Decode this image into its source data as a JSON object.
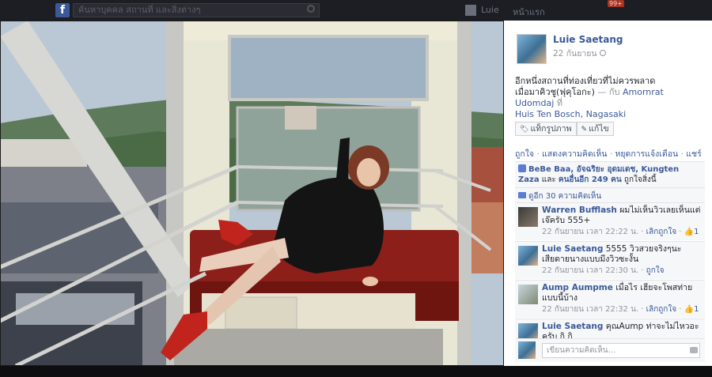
{
  "topbar": {
    "search_placeholder": "ค้นหาบุคคล สถานที่ และสิ่งต่างๆ",
    "user_label": "Luie",
    "home_label": "หน้าแรก",
    "notif_count": "99+"
  },
  "post": {
    "author": "Luie Saetang",
    "date": "22 กันยายน",
    "text_line1": "อีกหนึ่งสถานที่ท่องเที่ยวที่ไม่ควรพลาด",
    "text_line2": "เมื่อมาคิวชู(ฟุคุโอกะ)",
    "with_prefix": "— กับ",
    "with_person": "Amornrat Udomdaj",
    "at_prefix": "ที่",
    "location": "Huis Ten Bosch, Nagasaki",
    "tag_button": "แท็กรูปภาพ",
    "edit_button": "แก้ไข",
    "action_like": "ถูกใจ",
    "action_comment": "แสดงความคิดเห็น",
    "action_stop_notify": "หยุดการแจ้งเตือน",
    "action_share": "แชร์",
    "likes_names": "BeBe Baa, อัจฉริยะ อุดมเดช, Kungten Zaza",
    "likes_and": "และ",
    "likes_others": "คนอื่นอีก 249 คน",
    "likes_suffix": "ถูกใจสิ่งนี้",
    "comments_link": "ดูอีก 30 ความคิดเห็น"
  },
  "comments": [
    {
      "name": "Warren Bufflash",
      "text": "ผมไม่เห็นวิวเลยเห็นแต่เจ๊ครับ 555+",
      "time": "22 กันยายน เวลา 22:22 น.",
      "like": "เลิกถูกใจ",
      "count": "1"
    },
    {
      "name": "Luie Saetang",
      "text": "5555 วิวสวยจริงๆนะ เสียดายนางแบบมีงวิวซะงั้น",
      "time": "22 กันยายน เวลา 22:30 น.",
      "like": "ถูกใจ",
      "count": ""
    },
    {
      "name": "Aump Aumpme",
      "text": "เมื่อไร เฮียจะโพสท่ายแบบนี้บ้าง",
      "time": "22 กันยายน เวลา 22:32 น.",
      "like": "เลิกถูกใจ",
      "count": "1"
    },
    {
      "name": "Luie Saetang",
      "text": "คุณAump ท่าจะไม่ไหวอะครับ กิ กิ",
      "time": "",
      "like": "",
      "count": ""
    }
  ],
  "reply_placeholder": "เขียนความคิดเห็น...",
  "colors": {
    "link": "#3b5998",
    "muted": "#90949c",
    "seat": "#8c1f1a",
    "shoes": "#c0241c"
  }
}
